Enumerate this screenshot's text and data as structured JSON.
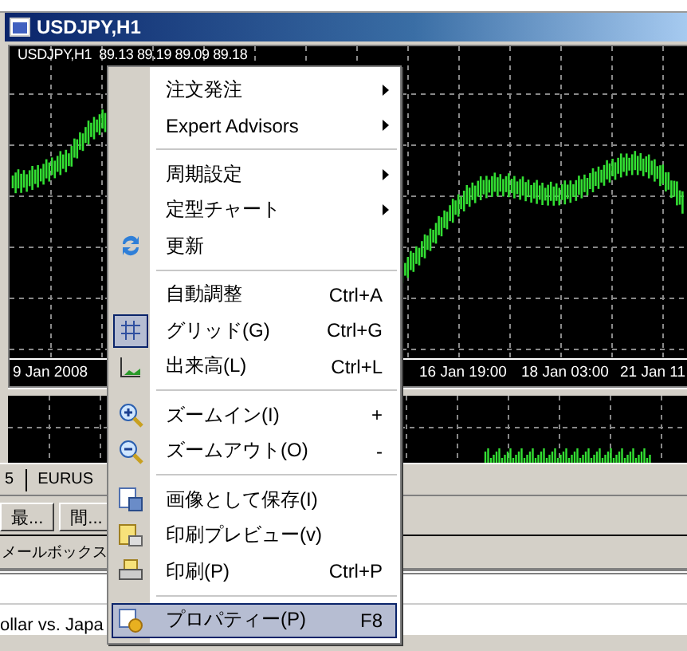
{
  "window": {
    "title": "USDJPY,H1"
  },
  "chart": {
    "header": "USDJPY,H1  89.13 89.19 89.09 89.18",
    "time_labels": [
      "9 Jan 2008",
      "16 Jan 19:00",
      "18 Jan 03:00",
      "21 Jan 11"
    ]
  },
  "terminal": {
    "tabs": [
      "5",
      "EURUS"
    ],
    "buttons": [
      "最...",
      "間..."
    ],
    "mail_tab": "メールボックス",
    "description": "ollar vs. Japa"
  },
  "context_menu": {
    "items": [
      {
        "kind": "item",
        "label": "注文発注",
        "submenu": true,
        "checked": false,
        "selected": false
      },
      {
        "kind": "item",
        "label": "Expert Advisors",
        "submenu": true,
        "checked": false,
        "selected": false
      },
      {
        "kind": "separator"
      },
      {
        "kind": "item",
        "label": "周期設定",
        "submenu": true,
        "checked": false,
        "selected": false
      },
      {
        "kind": "item",
        "label": "定型チャート",
        "submenu": true,
        "checked": false,
        "selected": false
      },
      {
        "kind": "item",
        "label": "更新",
        "submenu": false,
        "checked": false,
        "selected": false
      },
      {
        "kind": "separator"
      },
      {
        "kind": "item",
        "label": "自動調整",
        "shortcut": "Ctrl+A",
        "submenu": false,
        "checked": false,
        "selected": false
      },
      {
        "kind": "item",
        "label": "グリッド(G)",
        "shortcut": "Ctrl+G",
        "submenu": false,
        "checked": true,
        "selected": false
      },
      {
        "kind": "item",
        "label": "出来高(L)",
        "shortcut": "Ctrl+L",
        "submenu": false,
        "checked": false,
        "selected": false
      },
      {
        "kind": "separator"
      },
      {
        "kind": "item",
        "label": "ズームイン(I)",
        "shortcut": "+",
        "submenu": false,
        "checked": false,
        "selected": false
      },
      {
        "kind": "item",
        "label": "ズームアウト(O)",
        "shortcut": "-",
        "submenu": false,
        "checked": false,
        "selected": false
      },
      {
        "kind": "separator"
      },
      {
        "kind": "item",
        "label": "画像として保存(I)",
        "submenu": false,
        "checked": false,
        "selected": false
      },
      {
        "kind": "item",
        "label": "印刷プレビュー(v)",
        "submenu": false,
        "checked": false,
        "selected": false
      },
      {
        "kind": "item",
        "label": "印刷(P)",
        "shortcut": "Ctrl+P",
        "submenu": false,
        "checked": false,
        "selected": false
      },
      {
        "kind": "separator"
      },
      {
        "kind": "item",
        "label": "プロパティー(P)",
        "shortcut": "F8",
        "submenu": false,
        "checked": false,
        "selected": true
      }
    ]
  }
}
